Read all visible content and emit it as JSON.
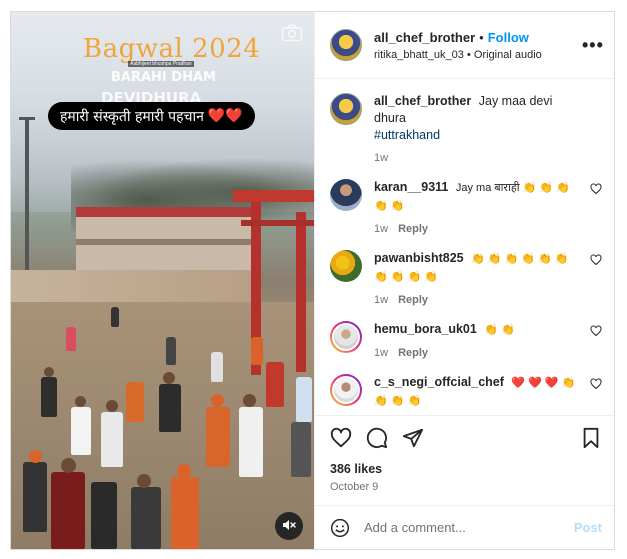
{
  "video": {
    "title": "Bagwal 2024",
    "small_caption": "Aabhijeet bhushpa Pradhan",
    "place_line1": "BARAHI DHAM",
    "place_line2": "DEVIDHURA",
    "pill_text": "हमारी संस्कृती हमारी पहचान",
    "pill_hearts": "❤️❤️",
    "icons": [
      "camera-icon",
      "mute-icon"
    ]
  },
  "header": {
    "username": "all_chef_brother",
    "separator": "•",
    "follow_label": "Follow",
    "audio_user": "ritika_bhatt_uk_03",
    "audio_sep": "•",
    "audio_label": "Original audio",
    "more_label": "•••"
  },
  "caption": {
    "username": "all_chef_brother",
    "text": "Jay maa devi dhura",
    "hashtag": "#uttrakhand",
    "time": "1w"
  },
  "comments": [
    {
      "username": "karan__9311",
      "text": "Jay ma बाराही 👏 👏 👏 👏 👏",
      "time": "1w",
      "reply": "Reply"
    },
    {
      "username": "pawanbisht825",
      "text": "👏 👏 👏 👏 👏 👏 👏 👏 👏 👏",
      "time": "1w",
      "reply": "Reply"
    },
    {
      "username": "hemu_bora_uk01",
      "text": "👏 👏",
      "time": "1w",
      "reply": "Reply"
    },
    {
      "username": "c_s_negi_offcial_chef",
      "text": "❤️ ❤️ ❤️ 👏 👏 👏 👏",
      "time": "",
      "reply": ""
    }
  ],
  "footer": {
    "likes": "386 likes",
    "date": "October 9",
    "comment_placeholder": "Add a comment...",
    "post_label": "Post"
  },
  "colors": {
    "accent": "#0095f6",
    "post_disabled": "#b2dffc",
    "heart": "#e0262b"
  }
}
